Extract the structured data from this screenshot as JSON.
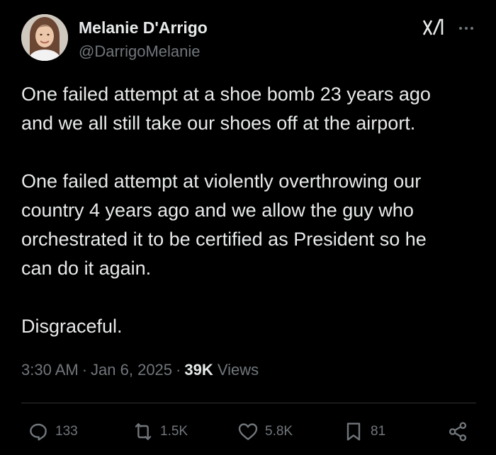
{
  "author": {
    "name": "Melanie D'Arrigo",
    "handle": "@DarrigoMelanie",
    "avatar_icon": "user-avatar-photo"
  },
  "header_icons": [
    "grok-icon",
    "more-options-icon"
  ],
  "tweet": {
    "text": "One failed attempt at a shoe bomb 23 years ago\nand we all still take our shoes off at the airport.\n\nOne failed attempt at violently overthrowing our\ncountry 4 years ago and we allow the guy who\norchestrated it to be certified as President so he\ncan do it again.\n\nDisgraceful."
  },
  "meta": {
    "time": "3:30 AM",
    "separator": "·",
    "date": "Jan 6, 2025",
    "views_count": "39K",
    "views_label": "Views"
  },
  "actions": {
    "replies": "133",
    "reposts": "1.5K",
    "likes": "5.8K",
    "bookmarks": "81"
  },
  "colors": {
    "background": "#000000",
    "text_primary": "#e7e9ea",
    "text_secondary": "#71767b",
    "divider": "#2f3336"
  }
}
